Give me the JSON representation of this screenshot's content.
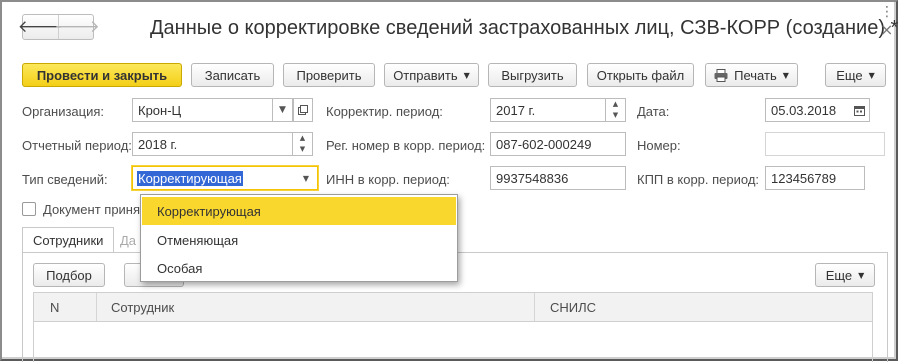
{
  "window": {
    "title": "Данные о корректировке сведений застрахованных лиц, СЗВ-КОРР (создание) *",
    "nav_back": "🡐",
    "nav_forward": "🡒",
    "more_icon": "⋮",
    "close_icon": "×"
  },
  "toolbar": {
    "post_close": "Провести и закрыть",
    "save": "Записать",
    "check": "Проверить",
    "send": "Отправить",
    "export": "Выгрузить",
    "open_file": "Открыть файл",
    "print": "Печать",
    "more": "Еще",
    "caret": "▼"
  },
  "form": {
    "org_label": "Организация:",
    "org_value": "Крон-Ц",
    "period_label": "Отчетный период:",
    "period_value": "2018 г.",
    "type_label": "Тип сведений:",
    "type_value": "Корректирующая",
    "doc_accepted_label": "Документ приня",
    "corr_period_label": "Корректир. период:",
    "corr_period_value": "2017 г.",
    "reg_num_label": "Рег. номер в корр. период:",
    "reg_num_value": "087-602-000249",
    "inn_label": "ИНН в корр. период:",
    "inn_value": "9937548836",
    "date_label": "Дата:",
    "date_value": "05.03.2018",
    "number_label": "Номер:",
    "number_value": "",
    "kpp_label": "КПП в корр. период:",
    "kpp_value": "123456789"
  },
  "tabs": [
    {
      "label": "Сотрудники"
    },
    {
      "label": "Да"
    }
  ],
  "table_toolbar": {
    "pick": "Подбор",
    "more": "Еще"
  },
  "table": {
    "columns": [
      "N",
      "Сотрудник",
      "СНИЛС"
    ],
    "rows": []
  },
  "dropdown": {
    "options": [
      "Корректирующая",
      "Отменяющая",
      "Особая"
    ],
    "selected": "Корректирующая"
  },
  "colors": {
    "primary_button": "#f4cf17",
    "selection_highlight": "#fad72d",
    "text_selection": "#3367d6"
  }
}
